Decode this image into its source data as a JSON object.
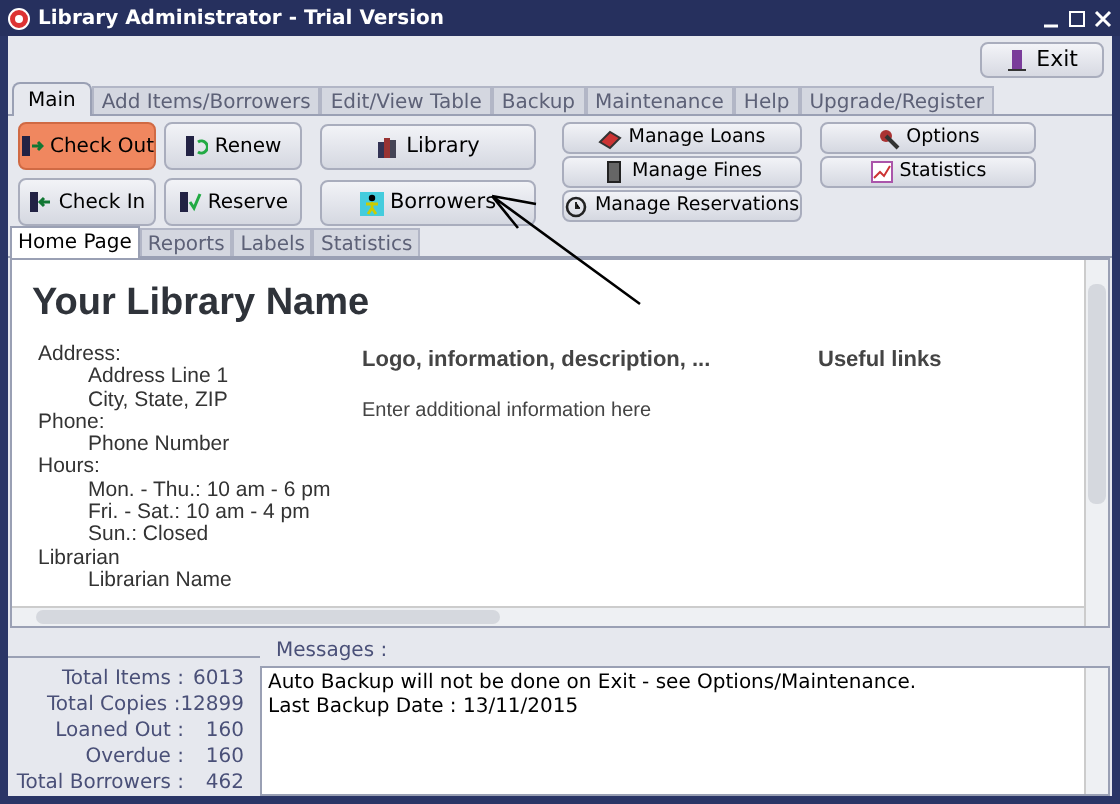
{
  "window": {
    "title": "Library Administrator - Trial Version"
  },
  "exit_button": {
    "label": "Exit"
  },
  "tabs": [
    {
      "label": "Main",
      "selected": true
    },
    {
      "label": "Add Items/Borrowers",
      "selected": false
    },
    {
      "label": "Edit/View Table",
      "selected": false
    },
    {
      "label": "Backup",
      "selected": false
    },
    {
      "label": "Maintenance",
      "selected": false
    },
    {
      "label": "Help",
      "selected": false
    },
    {
      "label": "Upgrade/Register",
      "selected": false
    }
  ],
  "button_groups": [
    [
      {
        "label": "Check Out",
        "highlighted": true
      },
      {
        "label": "Renew",
        "highlighted": false
      },
      {
        "label": "Check In",
        "highlighted": false
      },
      {
        "label": "Reserve",
        "highlighted": false
      }
    ],
    [
      {
        "label": "Library",
        "highlighted": false
      },
      {
        "label": "Borrowers",
        "highlighted": false
      }
    ],
    [
      {
        "label": "Manage Loans",
        "highlighted": false
      },
      {
        "label": "Manage Fines",
        "highlighted": false
      },
      {
        "label": "Manage Reservations",
        "highlighted": false
      }
    ],
    [
      {
        "label": "Options",
        "highlighted": false
      },
      {
        "label": "Statistics",
        "highlighted": false
      }
    ]
  ],
  "subtabs": [
    {
      "label": "Home Page",
      "selected": true
    },
    {
      "label": "Reports",
      "selected": false
    },
    {
      "label": "Labels",
      "selected": false
    },
    {
      "label": "Statistics",
      "selected": false
    }
  ],
  "home_page": {
    "title": "Your Library Name",
    "details": [
      {
        "label": "Address:",
        "values": [
          "Address Line 1",
          "City, State, ZIP"
        ]
      },
      {
        "label": "Phone:",
        "values": [
          "Phone Number"
        ]
      },
      {
        "label": "Hours:",
        "values": [
          "Mon. - Thu.: 10 am - 6 pm",
          "Fri. - Sat.: 10 am - 4 pm",
          "Sun.: Closed"
        ]
      },
      {
        "label": "Librarian",
        "values": [
          "Librarian Name"
        ]
      }
    ],
    "info_heading": "Logo, information, description, ...",
    "info_text": "Enter additional information here",
    "links_heading": "Useful links"
  },
  "stats": [
    {
      "label": "Total Items :",
      "value": "6013"
    },
    {
      "label": "Total Copies :",
      "value": "12899"
    },
    {
      "label": "Loaned Out :",
      "value": "160"
    },
    {
      "label": "Overdue :",
      "value": "160"
    },
    {
      "label": "Total Borrowers :",
      "value": "462"
    }
  ],
  "messages": {
    "label": "Messages :",
    "lines": [
      "Auto Backup will not be done on Exit - see Options/Maintenance.",
      "Last Backup Date : 13/11/2015"
    ]
  }
}
